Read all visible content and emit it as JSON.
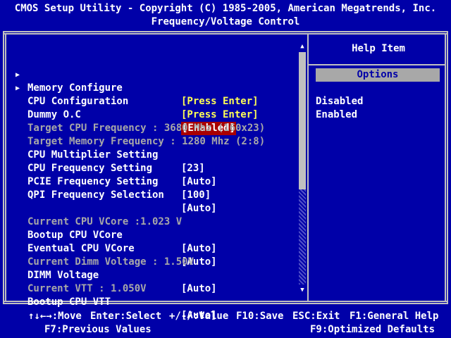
{
  "header": {
    "title": "CMOS Setup Utility - Copyright (C) 1985-2005, American Megatrends, Inc.",
    "subtitle": "Frequency/Voltage Control"
  },
  "colors": {
    "background": "#0000a8",
    "text_white": "#ffffff",
    "text_yellow": "#ffff55",
    "text_grey": "#a8a8a8",
    "highlight": "#a80000"
  },
  "settings": [
    {
      "label": "Memory Configure",
      "value": "[Press Enter]",
      "submenu": true
    },
    {
      "label": "CPU Configuration",
      "value": "[Press Enter]",
      "submenu": true
    },
    {
      "label": "Dummy O.C",
      "value": "[Enabled]",
      "selected": true
    },
    {
      "text": "Target CPU Frequency : 3680 Mhz (160x23)",
      "readonly": true
    },
    {
      "text": "Target Memory Frequency : 1280 Mhz (2:8)",
      "readonly": true
    },
    {
      "label": "CPU Multiplier Setting",
      "value": "[23]"
    },
    {
      "label": "CPU Frequency Setting",
      "value": "[Auto]"
    },
    {
      "label": "PCIE Frequency Setting",
      "value": "[100]"
    },
    {
      "label": "QPI Frequency Selection",
      "value": "[Auto]"
    },
    {
      "text": "Current CPU VCore :1.023 V",
      "readonly": true
    },
    {
      "label": "Bootup CPU VCore",
      "value": "[Auto]"
    },
    {
      "label": "Eventual CPU VCore",
      "value": "[Auto]"
    },
    {
      "text": "Current Dimm Voltage : 1.50V",
      "readonly": true
    },
    {
      "label": "DIMM Voltage",
      "value": "[Auto]"
    },
    {
      "text": "Current VTT : 1.050V",
      "readonly": true
    },
    {
      "label": "Bootup CPU VTT",
      "value": "[Auto]"
    }
  ],
  "help": {
    "title": "Help Item",
    "options_label": "Options",
    "options": [
      "Disabled",
      "Enabled"
    ]
  },
  "footer": {
    "nav": "↑↓←→:Move",
    "enter": "Enter:Select",
    "value": "+/-/:Value",
    "save": "F10:Save",
    "exit": "ESC:Exit",
    "help": "F1:General Help",
    "previous": "F7:Previous Values",
    "optimized": "F9:Optimized Defaults"
  },
  "scrollbar": {
    "up_icon": "triangle-up-icon",
    "down_icon": "triangle-down-icon",
    "thumb_fraction": 0.59
  }
}
